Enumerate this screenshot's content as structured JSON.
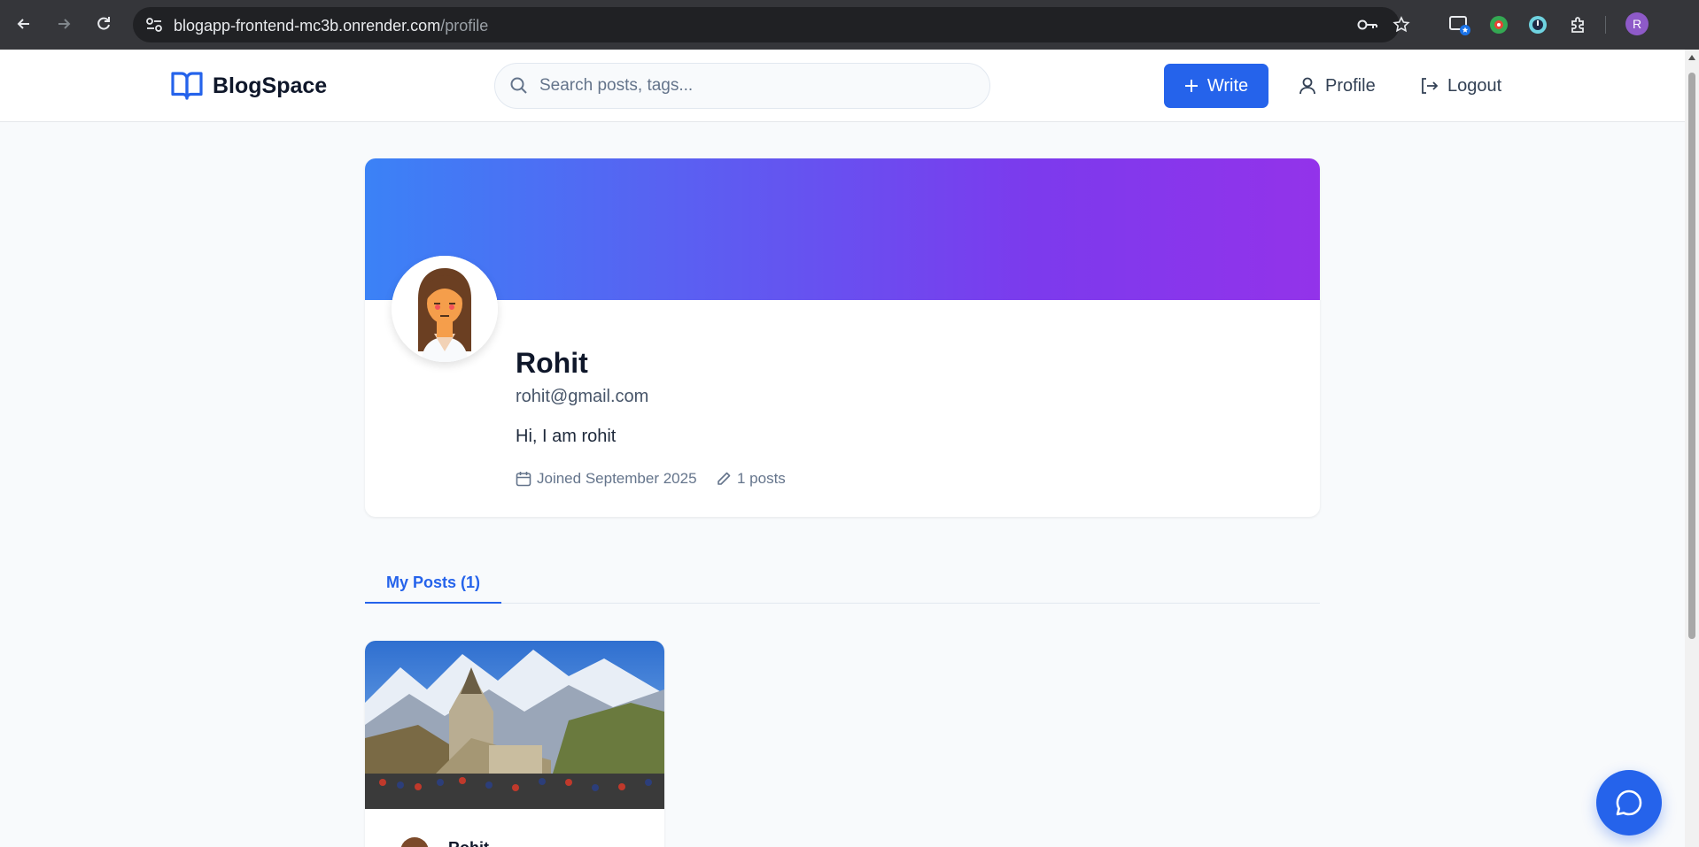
{
  "browser": {
    "url_host": "blogapp-frontend-mc3b.onrender.com",
    "url_path": "/profile",
    "profile_initial": "R"
  },
  "header": {
    "brand": "BlogSpace",
    "search_placeholder": "Search posts, tags...",
    "write_label": "Write",
    "profile_label": "Profile",
    "logout_label": "Logout"
  },
  "profile": {
    "name": "Rohit",
    "email": "rohit@gmail.com",
    "bio": "Hi, I am rohit",
    "joined": "Joined September 2025",
    "posts_count": "1 posts"
  },
  "tabs": [
    {
      "label": "My Posts (1)",
      "active": true
    }
  ],
  "posts": [
    {
      "author": "Rohit"
    }
  ],
  "colors": {
    "primary": "#2563eb",
    "banner_start": "#3b82f6",
    "banner_end": "#9333ea"
  }
}
